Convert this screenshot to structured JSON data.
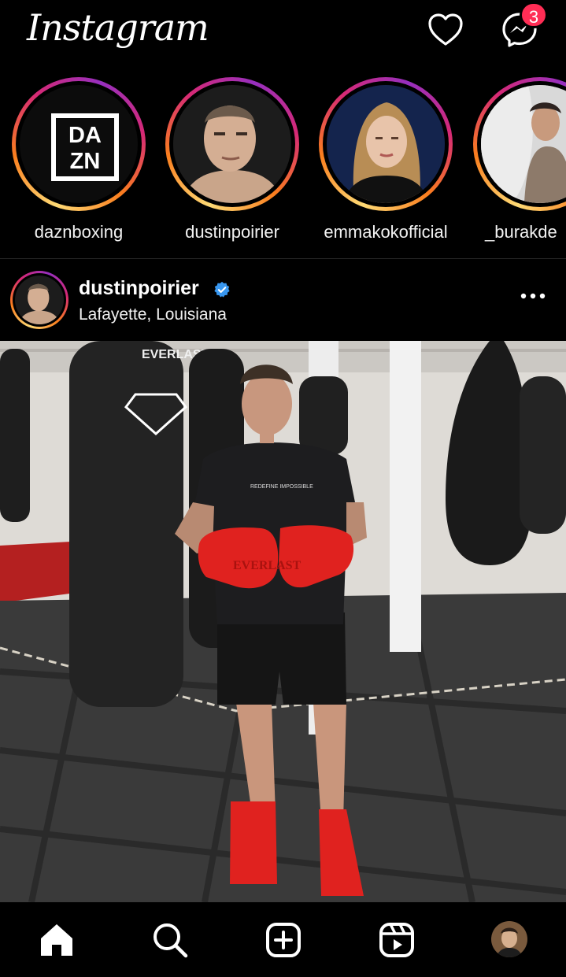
{
  "app": {
    "title": "Instagram",
    "notification_count": "3"
  },
  "stories": [
    {
      "username": "daznboxing",
      "avatar_text_top": "DA",
      "avatar_text_bottom": "ZN"
    },
    {
      "username": "dustinpoirier"
    },
    {
      "username": "emmakokofficial"
    },
    {
      "username": "_burakde"
    }
  ],
  "post": {
    "username": "dustinpoirier",
    "verified": true,
    "location": "Lafayette, Louisiana",
    "photo_text": {
      "bag_brand": "EVERLAST",
      "glove_brand": "EVERLAST",
      "shirt_text": "REDEFINE IMPOSSIBLE"
    }
  },
  "nav": {
    "items": [
      "home-icon",
      "search-icon",
      "create-post-icon",
      "reels-icon",
      "profile-avatar"
    ]
  },
  "colors": {
    "background": "#000000",
    "badge": "#ff2d55",
    "verified": "#3897f0",
    "glove_red": "#e0221f"
  }
}
